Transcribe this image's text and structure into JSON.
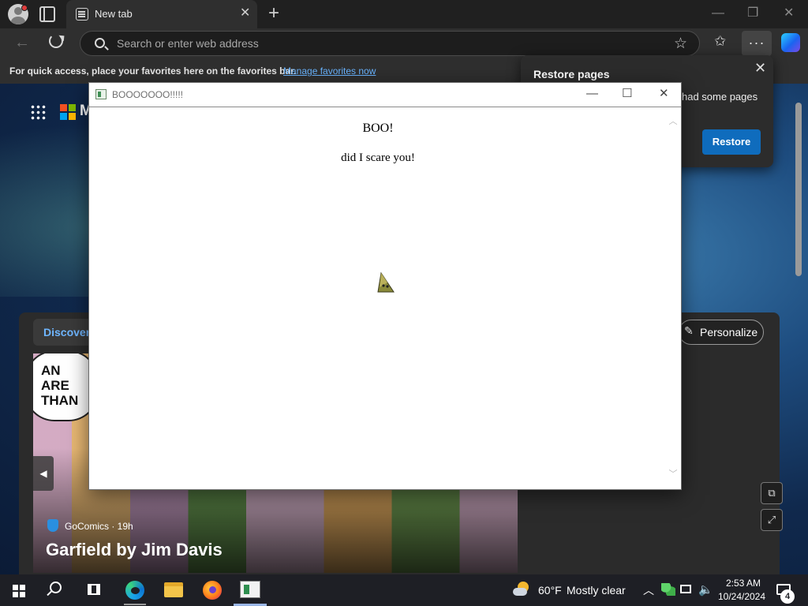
{
  "browser": {
    "tab": {
      "title": "New tab",
      "close": "✕"
    },
    "new_tab": "+",
    "window_controls": {
      "minimize": "—",
      "restore": "❐",
      "close": "✕"
    },
    "nav": {
      "back": "←",
      "star": "☆",
      "favorites": "✩",
      "more": "···"
    },
    "address": {
      "placeholder": "Search or enter web address",
      "value": ""
    },
    "favorites_bar": {
      "text": "For quick access, place your favorites here on the favorites bar.",
      "link": "Manage favorites now"
    }
  },
  "newtab_page": {
    "brand_initial": "M",
    "ms_colors": [
      "#f25022",
      "#7fba00",
      "#00a4ef",
      "#ffb900"
    ],
    "feed": {
      "tab": "Discover",
      "personalize": "Personalize",
      "card": {
        "bubble_text": "AN\nARE\nTHAN",
        "prev": "◀",
        "source": "GoComics · 19h",
        "title": "Garfield by Jim Davis"
      },
      "side_buttons": {
        "open": "⧉",
        "expand": "⤢"
      }
    }
  },
  "restore_popup": {
    "title": "Restore pages",
    "close": "✕",
    "message": "had some pages",
    "button": "Restore",
    "button_color": "#0f6cbd"
  },
  "boo_window": {
    "title": "BOOOOOOO!!!!!",
    "controls": {
      "minimize": "—",
      "maximize": "☐",
      "close": "✕"
    },
    "heading": "BOO!",
    "message": "did I scare you!",
    "scroll_up": "︿",
    "scroll_down": "﹀"
  },
  "taskbar": {
    "weather": {
      "temp": "60°F",
      "condition": "Mostly clear"
    },
    "tray_chevron": "︿",
    "volume": "🔈",
    "time": "2:53 AM",
    "date": "10/24/2024",
    "notification_count": "4"
  }
}
